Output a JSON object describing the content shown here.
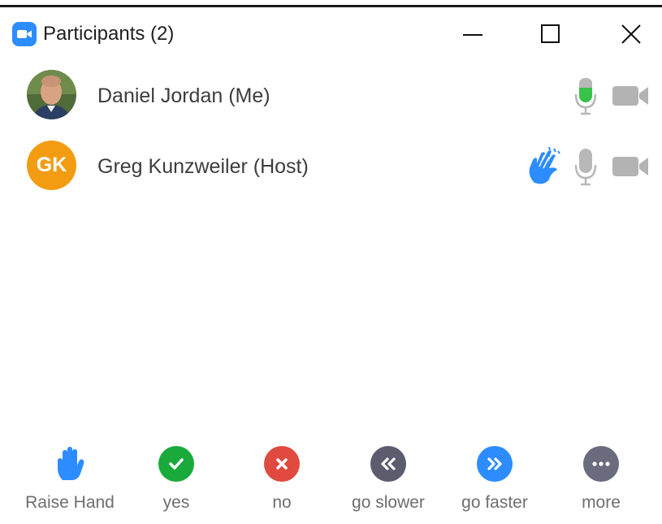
{
  "window": {
    "title": "Participants (2)",
    "controls": [
      "minimize",
      "maximize",
      "close"
    ]
  },
  "participants": [
    {
      "name": "Daniel Jordan (Me)",
      "avatar": "photo",
      "mic": "active-speaking",
      "video": "off"
    },
    {
      "name": "Greg Kunzweiler (Host)",
      "initials": "GK",
      "avatar_color": "#f39c12",
      "reaction": "clap-icon",
      "mic": "muted-gray",
      "video": "off"
    }
  ],
  "reactions": [
    {
      "label": "Raise Hand",
      "icon": "raise-hand-icon",
      "color": "#2d8cff"
    },
    {
      "label": "yes",
      "icon": "check-icon",
      "color": "#1aaa3b"
    },
    {
      "label": "no",
      "icon": "x-icon",
      "color": "#e04a3f"
    },
    {
      "label": "go slower",
      "icon": "rewind-icon",
      "color": "#5b5d6e"
    },
    {
      "label": "go faster",
      "icon": "fast-forward-icon",
      "color": "#2d8cff"
    },
    {
      "label": "more",
      "icon": "ellipsis-icon",
      "color": "#6a6c7d"
    }
  ],
  "colors": {
    "accent": "#2d8cff",
    "mic_active": "#37c24a",
    "icon_gray": "#b3b3b3"
  }
}
